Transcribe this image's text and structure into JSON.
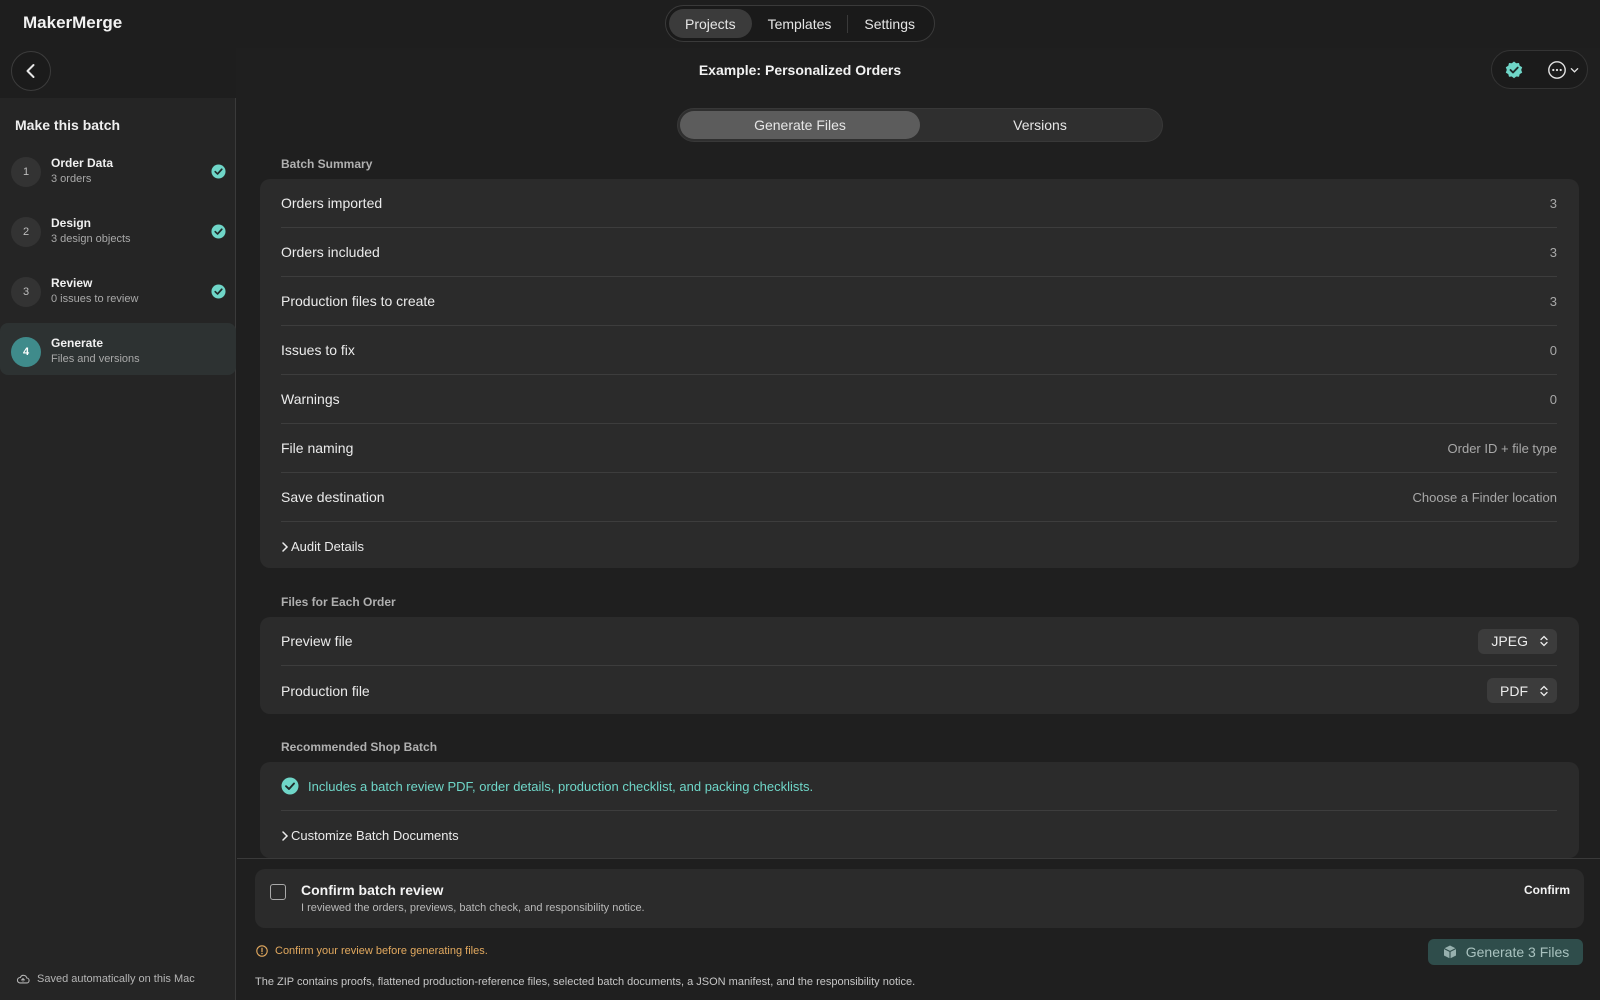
{
  "app": {
    "title": "MakerMerge"
  },
  "top_nav": {
    "tabs": [
      "Projects",
      "Templates",
      "Settings"
    ],
    "active": "Projects"
  },
  "sidebar": {
    "heading": "Make this batch",
    "steps": [
      {
        "num": "1",
        "title": "Order Data",
        "subtitle": "3 orders",
        "done": true
      },
      {
        "num": "2",
        "title": "Design",
        "subtitle": "3 design objects",
        "done": true
      },
      {
        "num": "3",
        "title": "Review",
        "subtitle": "0 issues to review",
        "done": true
      },
      {
        "num": "4",
        "title": "Generate",
        "subtitle": "Files and versions",
        "done": false,
        "active": true
      }
    ],
    "saved_text": "Saved automatically on this Mac"
  },
  "header": {
    "doc_title": "Example: Personalized Orders"
  },
  "main_tabs": {
    "tabs": [
      "Generate Files",
      "Versions"
    ],
    "active": "Generate Files"
  },
  "batch_summary": {
    "label": "Batch Summary",
    "rows": [
      {
        "label": "Orders imported",
        "value": "3"
      },
      {
        "label": "Orders included",
        "value": "3"
      },
      {
        "label": "Production files to create",
        "value": "3"
      },
      {
        "label": "Issues to fix",
        "value": "0"
      },
      {
        "label": "Warnings",
        "value": "0"
      },
      {
        "label": "File naming",
        "value": "Order ID + file type"
      },
      {
        "label": "Save destination",
        "value": "Choose a Finder location"
      }
    ],
    "audit_label": "Audit Details"
  },
  "files_each_order": {
    "label": "Files for Each Order",
    "preview": {
      "label": "Preview file",
      "value": "JPEG"
    },
    "production": {
      "label": "Production file",
      "value": "PDF"
    }
  },
  "shop_batch": {
    "label": "Recommended Shop Batch",
    "included_text": "Includes a batch review PDF, order details, production checklist, and packing checklists.",
    "customize_label": "Customize Batch Documents"
  },
  "confirm": {
    "title": "Confirm batch review",
    "subtitle": "I reviewed the orders, previews, batch check, and responsibility notice.",
    "button": "Confirm",
    "checked": false
  },
  "footer": {
    "warning": "Confirm your review before generating files.",
    "generate_button": "Generate 3 Files",
    "zip_note": "The ZIP contains proofs, flattened production-reference files, selected batch documents, a JSON manifest, and the responsibility notice."
  },
  "colors": {
    "accent": "#6fd6c8",
    "warning": "#e2a95f",
    "active_step": "#3f8b8b"
  }
}
